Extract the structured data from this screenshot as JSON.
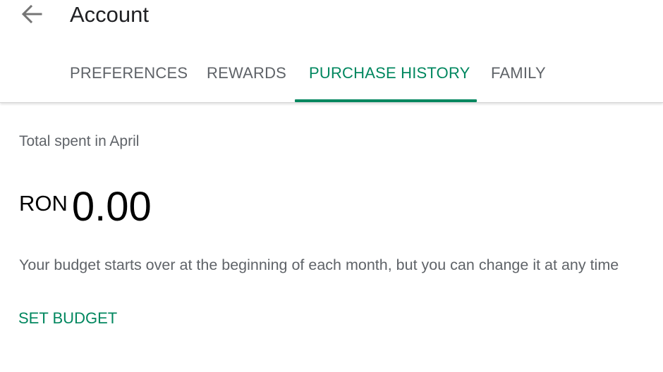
{
  "header": {
    "title": "Account",
    "back_icon": "arrow-back-icon"
  },
  "tabs": [
    {
      "label": "PREFERENCES",
      "active": false
    },
    {
      "label": "REWARDS",
      "active": false
    },
    {
      "label": "PURCHASE HISTORY",
      "active": true
    },
    {
      "label": "FAMILY",
      "active": false
    }
  ],
  "purchase_history": {
    "total_label": "Total spent in April",
    "currency": "RON",
    "amount": "0.00",
    "description": "Your budget starts over at the beginning of each month, but you can change it at any time",
    "set_budget_label": "SET BUDGET"
  },
  "colors": {
    "accent": "#01875f",
    "secondary_text": "#5f6368",
    "primary_text": "#202124"
  }
}
